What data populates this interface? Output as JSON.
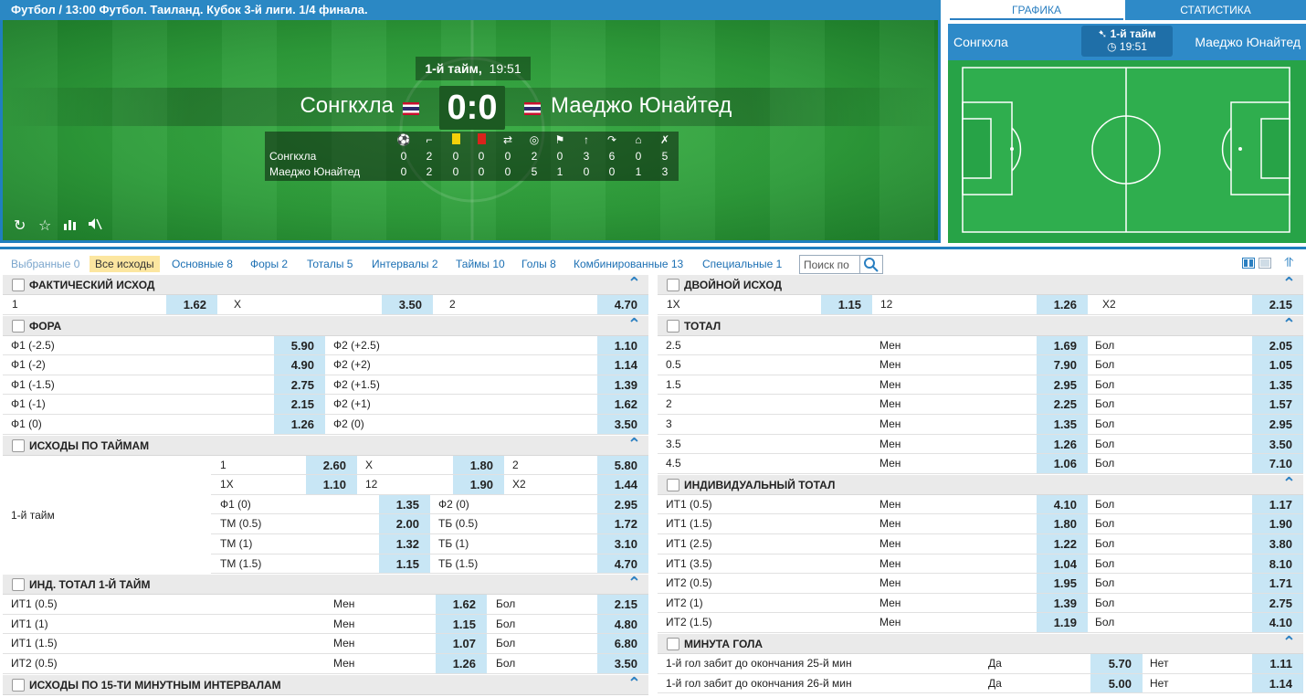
{
  "breadcrumb": "Футбол  /  13:00 Футбол. Таиланд. Кубок 3-й лиги. 1/4 финала.",
  "match": {
    "half_label": "1-й тайм,",
    "time": "19:51",
    "team1": "Сонгкхла",
    "team2": "Маеджо Юнайтед",
    "score": "0:0"
  },
  "stats": {
    "icons": [
      "ball-icon",
      "corner-icon",
      "yellow-card-icon",
      "red-card-icon",
      "substitution-icon",
      "shot-on-target-icon",
      "offside-icon",
      "throw-in-icon",
      "free-kick-icon",
      "goal-kick-icon",
      "shot-off-target-icon"
    ],
    "rows": [
      {
        "team": "Сонгкхла",
        "values": [
          "0",
          "2",
          "0",
          "0",
          "0",
          "2",
          "0",
          "3",
          "6",
          "0",
          "5"
        ]
      },
      {
        "team": "Маеджо Юнайтед",
        "values": [
          "0",
          "2",
          "0",
          "0",
          "0",
          "5",
          "1",
          "0",
          "0",
          "1",
          "3"
        ]
      }
    ]
  },
  "stage_buttons": [
    "refresh-icon",
    "star-icon",
    "stats-icon",
    "mute-icon"
  ],
  "side": {
    "tabs": [
      "ГРАФИКА",
      "СТАТИСТИКА"
    ],
    "team1": "Сонгкхла",
    "team2": "Маеджо Юнайтед",
    "half": "1-й тайм",
    "time": "19:51"
  },
  "filters": [
    {
      "label": "Выбранные 0",
      "state": "dim"
    },
    {
      "label": "Все исходы",
      "state": "sel"
    },
    {
      "label": "Основные 8",
      "state": ""
    },
    {
      "label": "Форы 2",
      "state": ""
    },
    {
      "label": "Тоталы 5",
      "state": ""
    },
    {
      "label": "Интервалы 2",
      "state": ""
    },
    {
      "label": "Таймы 10",
      "state": ""
    },
    {
      "label": "Голы 8",
      "state": ""
    },
    {
      "label": "Комбинированные 13",
      "state": ""
    },
    {
      "label": "Специальные 1",
      "state": ""
    }
  ],
  "search_placeholder": "Поиск по",
  "left_sections": [
    {
      "title": "ФАКТИЧЕСКИЙ ИСХОД",
      "layout": "three",
      "rows": [
        [
          "1",
          "1.62",
          "Х",
          "3.50",
          "2",
          "4.70"
        ]
      ]
    },
    {
      "title": "ФОРА",
      "layout": "two",
      "rows": [
        [
          "Ф1 (-2.5)",
          "5.90",
          "Ф2 (+2.5)",
          "1.10"
        ],
        [
          "Ф1 (-2)",
          "4.90",
          "Ф2 (+2)",
          "1.14"
        ],
        [
          "Ф1 (-1.5)",
          "2.75",
          "Ф2 (+1.5)",
          "1.39"
        ],
        [
          "Ф1 (-1)",
          "2.15",
          "Ф2 (+1)",
          "1.62"
        ],
        [
          "Ф1 (0)",
          "1.26",
          "Ф2 (0)",
          "3.50"
        ]
      ]
    },
    {
      "title": "ИСХОДЫ ПО ТАЙМАМ",
      "layout": "halves",
      "period": "1-й тайм",
      "rows3": [
        [
          "1",
          "2.60",
          "Х",
          "1.80",
          "2",
          "5.80"
        ],
        [
          "1Х",
          "1.10",
          "12",
          "1.90",
          "Х2",
          "1.44"
        ]
      ],
      "rows2": [
        [
          "Ф1 (0)",
          "1.35",
          "Ф2 (0)",
          "2.95"
        ],
        [
          "ТМ (0.5)",
          "2.00",
          "ТБ (0.5)",
          "1.72"
        ],
        [
          "ТМ (1)",
          "1.32",
          "ТБ (1)",
          "3.10"
        ],
        [
          "ТМ (1.5)",
          "1.15",
          "ТБ (1.5)",
          "4.70"
        ]
      ]
    },
    {
      "title": "ИНД. ТОТАЛ 1-Й ТАЙМ",
      "layout": "total",
      "rows": [
        [
          "ИТ1 (0.5)",
          "Мен",
          "1.62",
          "Бол",
          "2.15"
        ],
        [
          "ИТ1 (1)",
          "Мен",
          "1.15",
          "Бол",
          "4.80"
        ],
        [
          "ИТ1 (1.5)",
          "Мен",
          "1.07",
          "Бол",
          "6.80"
        ],
        [
          "ИТ2 (0.5)",
          "Мен",
          "1.26",
          "Бол",
          "3.50"
        ]
      ]
    },
    {
      "title": "ИСХОДЫ ПО 15-ТИ МИНУТНЫМ ИНТЕРВАЛАМ",
      "layout": "none",
      "rows": []
    }
  ],
  "right_sections": [
    {
      "title": "ДВОЙНОЙ ИСХОД",
      "layout": "three",
      "rows": [
        [
          "1Х",
          "1.15",
          "12",
          "1.26",
          "Х2",
          "2.15"
        ]
      ]
    },
    {
      "title": "ТОТАЛ",
      "layout": "total",
      "rows": [
        [
          "2.5",
          "Мен",
          "1.69",
          "Бол",
          "2.05"
        ],
        [
          "0.5",
          "Мен",
          "7.90",
          "Бол",
          "1.05"
        ],
        [
          "1.5",
          "Мен",
          "2.95",
          "Бол",
          "1.35"
        ],
        [
          "2",
          "Мен",
          "2.25",
          "Бол",
          "1.57"
        ],
        [
          "3",
          "Мен",
          "1.35",
          "Бол",
          "2.95"
        ],
        [
          "3.5",
          "Мен",
          "1.26",
          "Бол",
          "3.50"
        ],
        [
          "4.5",
          "Мен",
          "1.06",
          "Бол",
          "7.10"
        ]
      ]
    },
    {
      "title": "ИНДИВИДУАЛЬНЫЙ ТОТАЛ",
      "layout": "total",
      "rows": [
        [
          "ИТ1 (0.5)",
          "Мен",
          "4.10",
          "Бол",
          "1.17"
        ],
        [
          "ИТ1 (1.5)",
          "Мен",
          "1.80",
          "Бол",
          "1.90"
        ],
        [
          "ИТ1 (2.5)",
          "Мен",
          "1.22",
          "Бол",
          "3.80"
        ],
        [
          "ИТ1 (3.5)",
          "Мен",
          "1.04",
          "Бол",
          "8.10"
        ],
        [
          "ИТ2 (0.5)",
          "Мен",
          "1.95",
          "Бол",
          "1.71"
        ],
        [
          "ИТ2 (1)",
          "Мен",
          "1.39",
          "Бол",
          "2.75"
        ],
        [
          "ИТ2 (1.5)",
          "Мен",
          "1.19",
          "Бол",
          "4.10"
        ]
      ]
    },
    {
      "title": "МИНУТА ГОЛА",
      "layout": "minute",
      "rows": [
        [
          "1-й гол забит до окончания 25-й мин",
          "Да",
          "5.70",
          "Нет",
          "1.11"
        ],
        [
          "1-й гол забит до окончания 26-й мин",
          "Да",
          "5.00",
          "Нет",
          "1.14"
        ]
      ]
    }
  ]
}
